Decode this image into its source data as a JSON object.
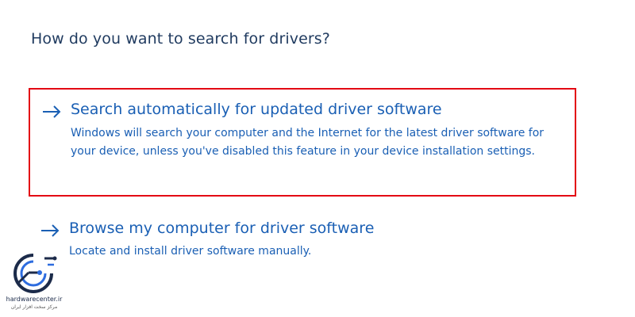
{
  "dialog": {
    "heading": "How do you want to search for drivers?",
    "options": [
      {
        "icon": "arrow-right-icon",
        "title": "Search automatically for updated driver software",
        "description": "Windows will search your computer and the Internet for the latest driver software for your device, unless you've disabled this feature in your device installation settings.",
        "highlighted": true
      },
      {
        "icon": "arrow-right-icon",
        "title": "Browse my computer for driver software",
        "description": "Locate and install driver software manually.",
        "highlighted": false
      }
    ]
  },
  "watermark": {
    "name": "hardwarecenter.ir",
    "tagline": "مرکز سخت افزار ایران"
  },
  "colors": {
    "link": "#1a5fb4",
    "heading": "#1f3a5f",
    "highlight_border": "#e30613",
    "logo_blue": "#1c2b4a",
    "background": "#ffffff"
  }
}
